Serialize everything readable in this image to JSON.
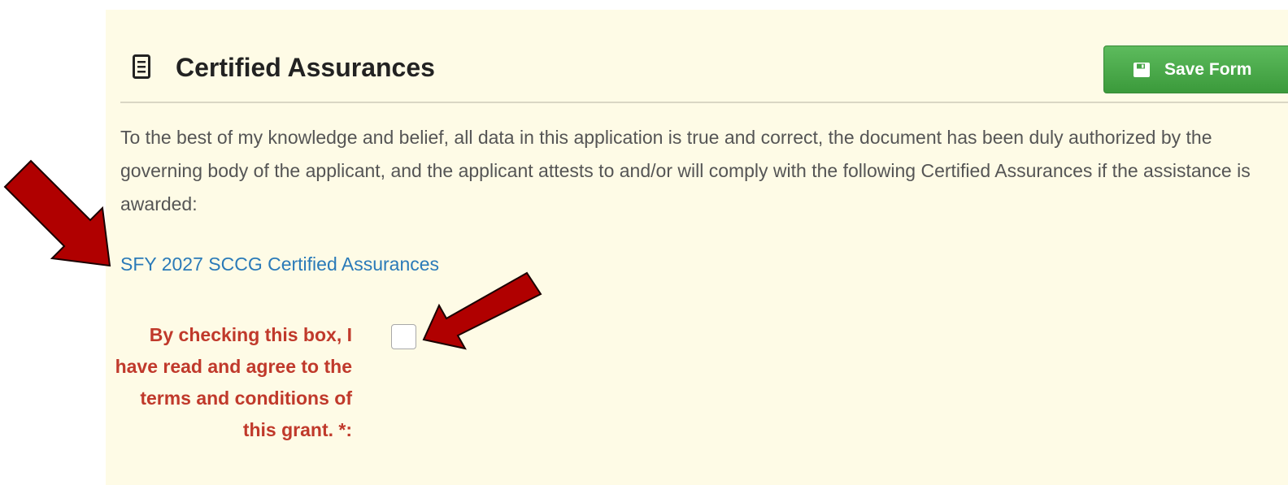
{
  "section": {
    "title": "Certified Assurances",
    "title_icon": "document-list-icon"
  },
  "toolbar": {
    "save_label": "Save Form",
    "save_icon": "floppy-disk-icon"
  },
  "content": {
    "intro": "To the best of my knowledge and belief, all data in this application is true and correct, the document has been duly authorized by the governing body of the applicant, and the applicant attests to and/or will comply with the following Certified Assurances if the assistance is awarded:",
    "link_text": "SFY 2027 SCCG Certified Assurances"
  },
  "agreement": {
    "label": "By checking this box, I have read and agree to the terms and conditions of this grant. *:",
    "checked": false
  },
  "annotations": {
    "arrow_color": "#b00000",
    "arrow_icon": "red-arrow-icon"
  },
  "colors": {
    "panel_background": "#fefbe6",
    "save_button": "#4cae4c",
    "link": "#2a7ab8",
    "required_label": "#c0392b"
  }
}
